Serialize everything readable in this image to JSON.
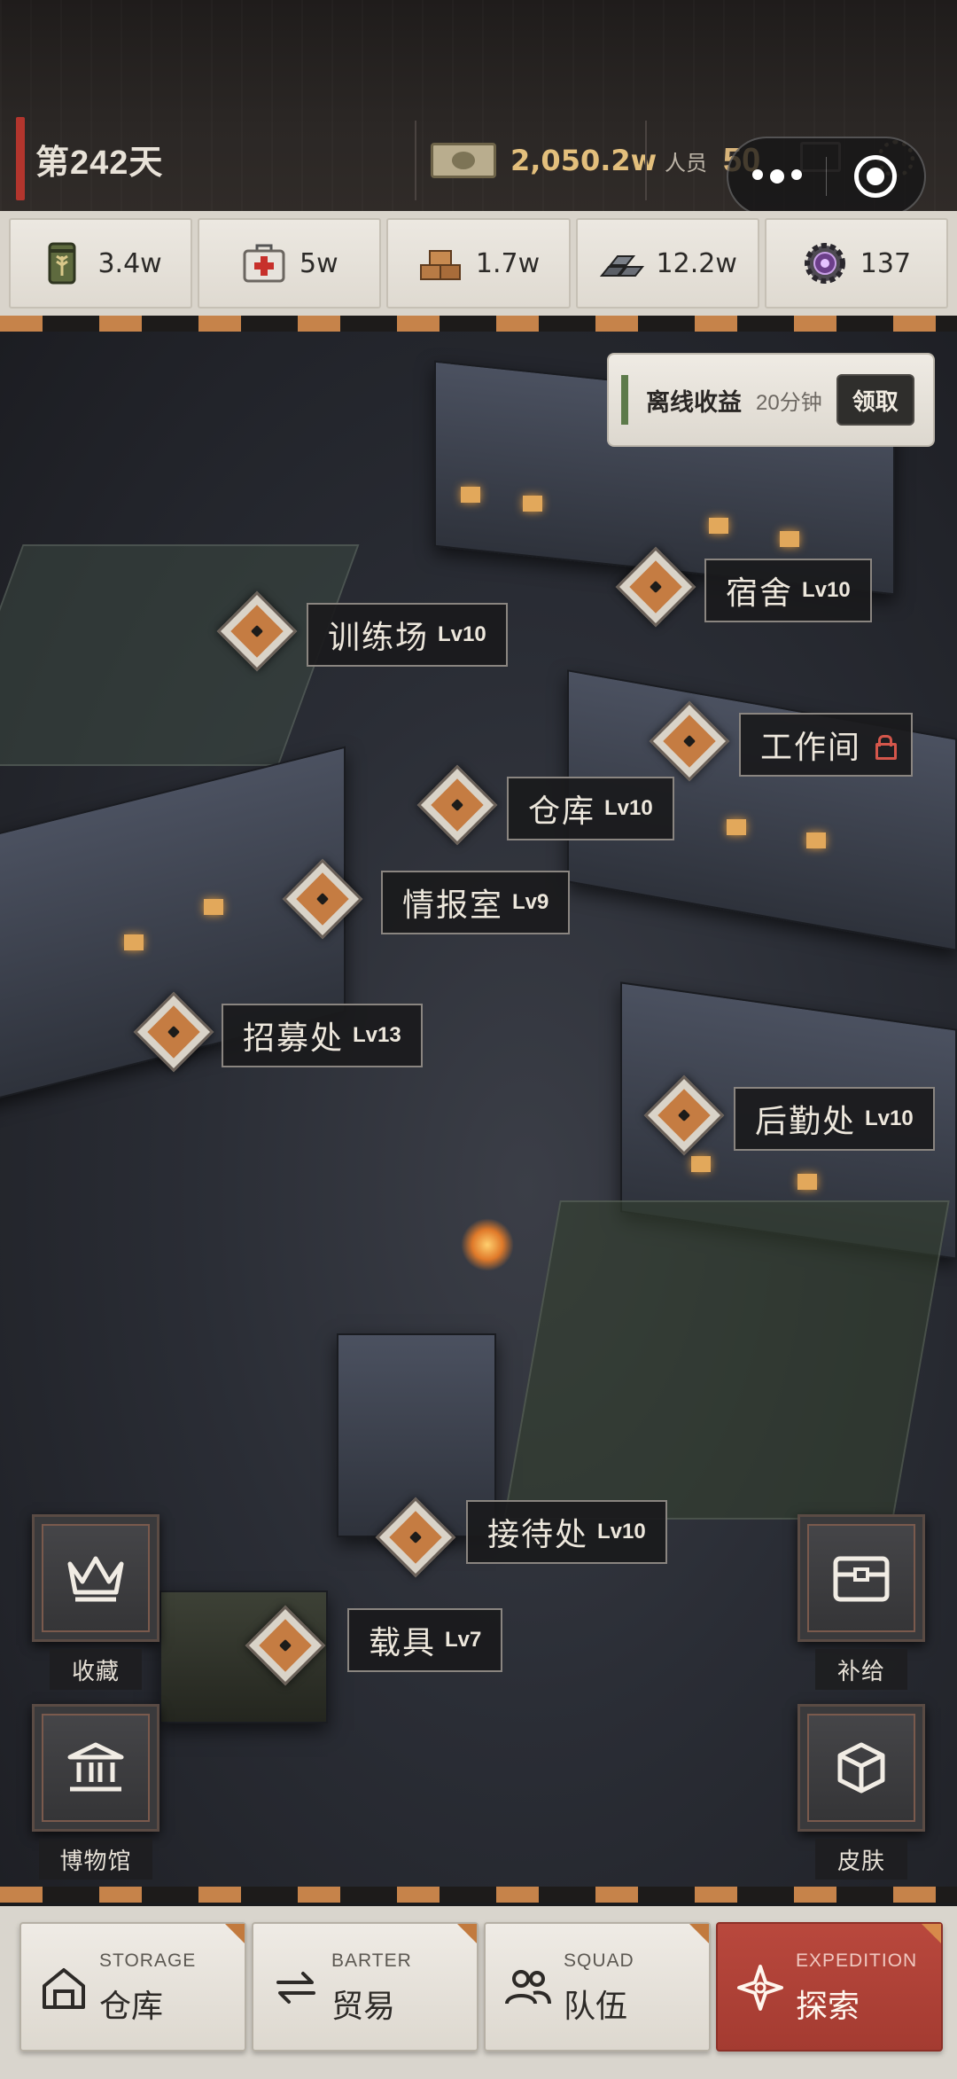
{
  "header": {
    "day_label": "第242天",
    "money": "2,050.2w",
    "staff_label": "人员",
    "staff_count": "50"
  },
  "resources": [
    {
      "icon": "grain-bag-icon",
      "value": "3.4w"
    },
    {
      "icon": "medkit-icon",
      "value": "5w"
    },
    {
      "icon": "wood-planks-icon",
      "value": "1.7w"
    },
    {
      "icon": "steel-ingots-icon",
      "value": "12.2w"
    },
    {
      "icon": "gear-chip-icon",
      "value": "137"
    }
  ],
  "offline": {
    "title": "离线收益",
    "duration": "20分钟",
    "claim_label": "领取"
  },
  "buildings": {
    "dormitory": {
      "name": "宿舍",
      "level": "Lv10"
    },
    "training": {
      "name": "训练场",
      "level": "Lv10"
    },
    "workshop": {
      "name": "工作间",
      "locked": true
    },
    "warehouse": {
      "name": "仓库",
      "level": "Lv10"
    },
    "intel": {
      "name": "情报室",
      "level": "Lv9"
    },
    "recruit": {
      "name": "招募处",
      "level": "Lv13"
    },
    "logistics": {
      "name": "后勤处",
      "level": "Lv10"
    },
    "reception": {
      "name": "接待处",
      "level": "Lv10"
    },
    "vehicle": {
      "name": "载具",
      "level": "Lv7"
    }
  },
  "side": {
    "collection": "收藏",
    "museum": "博物馆",
    "supply": "补给",
    "skin": "皮肤"
  },
  "nav": [
    {
      "en": "STORAGE",
      "cn": "仓库"
    },
    {
      "en": "BARTER",
      "cn": "贸易"
    },
    {
      "en": "SQUAD",
      "cn": "队伍"
    },
    {
      "en": "EXPEDITION",
      "cn": "探索"
    }
  ],
  "colors": {
    "accent_orange": "#c57c42",
    "active_tab": "#a43b31",
    "day_bar": "#b2352d"
  }
}
